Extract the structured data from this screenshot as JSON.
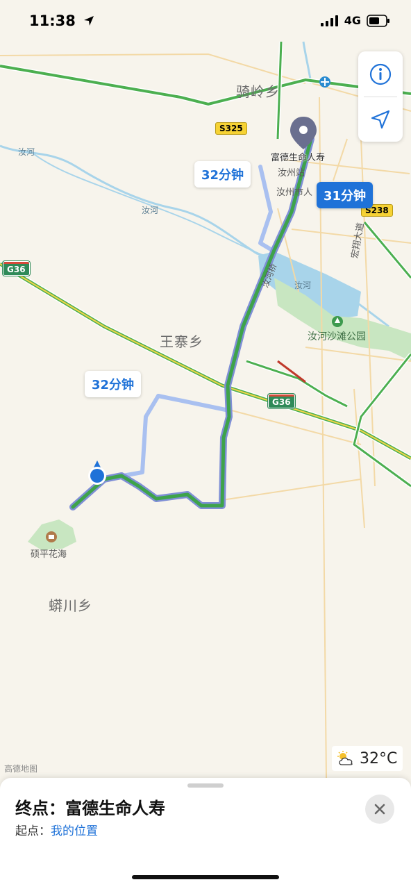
{
  "status_bar": {
    "time": "11:38",
    "network": "4G"
  },
  "map": {
    "town_labels": [
      "骑岭乡",
      "王寨乡",
      "蟒川乡"
    ],
    "place_labels": [
      "汝州站",
      "汝州市人",
      "宏翔大道"
    ],
    "water_labels": [
      "汝河",
      "汝河",
      "汝河"
    ],
    "bridge_label": "汝河桥",
    "poi": {
      "park": "汝河沙滩公园",
      "scenic": "硕平花海"
    },
    "destination_pin_label": "富德生命人寿",
    "road_shields": {
      "s325": "S325",
      "s238": "S238",
      "g36_west": "G36",
      "g36_east": "G36"
    },
    "route_bubbles": {
      "main": "31分钟",
      "alt_north": "32分钟",
      "alt_south": "32分钟"
    },
    "attribution": "高德地图",
    "colors": {
      "route_main": "#3ea34a",
      "route_main_outline": "#7f8fd6",
      "route_alt": "#a9c0f0",
      "water": "#a8d4ea",
      "park": "#c8e6c1"
    }
  },
  "controls": {
    "info_icon": "info-icon",
    "locate_icon": "location-arrow-icon"
  },
  "weather": {
    "icon": "partly-cloudy-icon",
    "temperature": "32°C"
  },
  "sheet": {
    "destination_title": "终点：富德生命人寿",
    "origin_prefix": "起点：",
    "origin_value": "我的位置"
  }
}
